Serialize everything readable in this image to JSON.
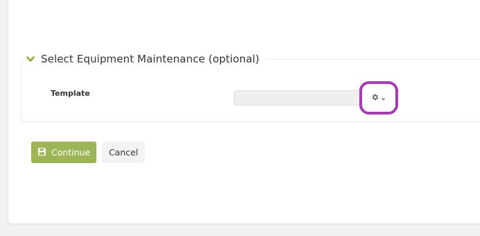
{
  "section": {
    "title": "Select Equipment Maintenance (optional)",
    "chevron_icon": "chevron-down-icon",
    "accent_color": "#8aaa3c"
  },
  "template_field": {
    "label": "Template",
    "value": "",
    "settings_icon": "gear-icon",
    "dropdown_icon": "caret-down-icon"
  },
  "highlight": {
    "color": "#a33db0"
  },
  "actions": {
    "continue_label": "Continue",
    "continue_icon": "save-icon",
    "continue_color": "#9db556",
    "cancel_label": "Cancel"
  }
}
